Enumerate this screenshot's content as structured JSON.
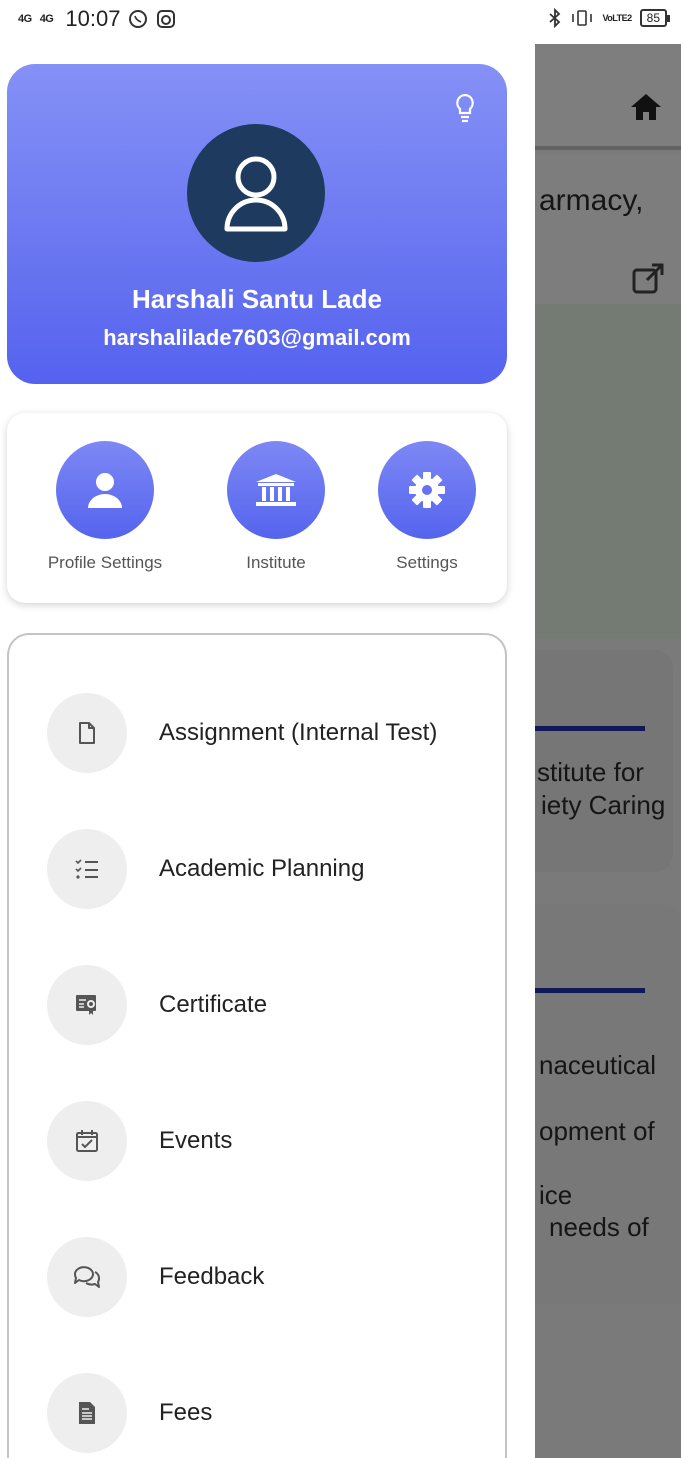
{
  "status_bar": {
    "signal1": "4G",
    "signal2": "4G",
    "time": "10:07",
    "volte": "VoLTE2",
    "battery": "85"
  },
  "background": {
    "text_1": "armacy,",
    "text_2": "stitute   for",
    "text_3": "iety Caring",
    "text_4": "naceutical",
    "text_5": "opment of",
    "text_6": "ice",
    "text_7": "needs   of"
  },
  "profile": {
    "name": "Harshali Santu Lade",
    "email": "harshalilade7603@gmail.com",
    "accent_color": "#5f6cf0",
    "avatar_color": "#1e3a5e"
  },
  "quick_actions": [
    {
      "label": "Profile Settings",
      "icon": "user-icon"
    },
    {
      "label": "Institute",
      "icon": "institute-icon"
    },
    {
      "label": "Settings",
      "icon": "gear-icon"
    }
  ],
  "menu": [
    {
      "label": "Assignment (Internal Test)",
      "icon": "document-icon"
    },
    {
      "label": "Academic Planning",
      "icon": "checklist-icon"
    },
    {
      "label": "Certificate",
      "icon": "certificate-icon"
    },
    {
      "label": "Events",
      "icon": "calendar-check-icon"
    },
    {
      "label": "Feedback",
      "icon": "chat-icon"
    },
    {
      "label": "Fees",
      "icon": "receipt-icon"
    }
  ]
}
